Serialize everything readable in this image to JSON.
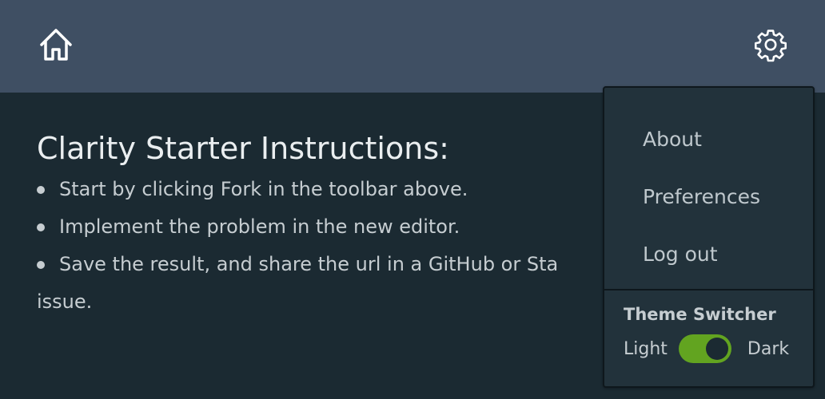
{
  "header": {
    "home_icon": "home-icon",
    "settings_icon": "gear-icon"
  },
  "main": {
    "title": "Clarity Starter Instructions:",
    "items": [
      "Start by clicking Fork in the toolbar above.",
      "Implement the problem in the new editor.",
      "Save the result, and share the url in a GitHub or Sta",
      "issue."
    ]
  },
  "dropdown": {
    "items": [
      "About",
      "Preferences",
      "Log out"
    ],
    "theme_header": "Theme Switcher",
    "toggle_left_label": "Light",
    "toggle_right_label": "Dark",
    "toggle_state": "dark"
  },
  "colors": {
    "header_bg": "#3f4f63",
    "content_bg": "#1b2a32",
    "dropdown_bg": "#22323b",
    "toggle_on": "#62a420"
  }
}
